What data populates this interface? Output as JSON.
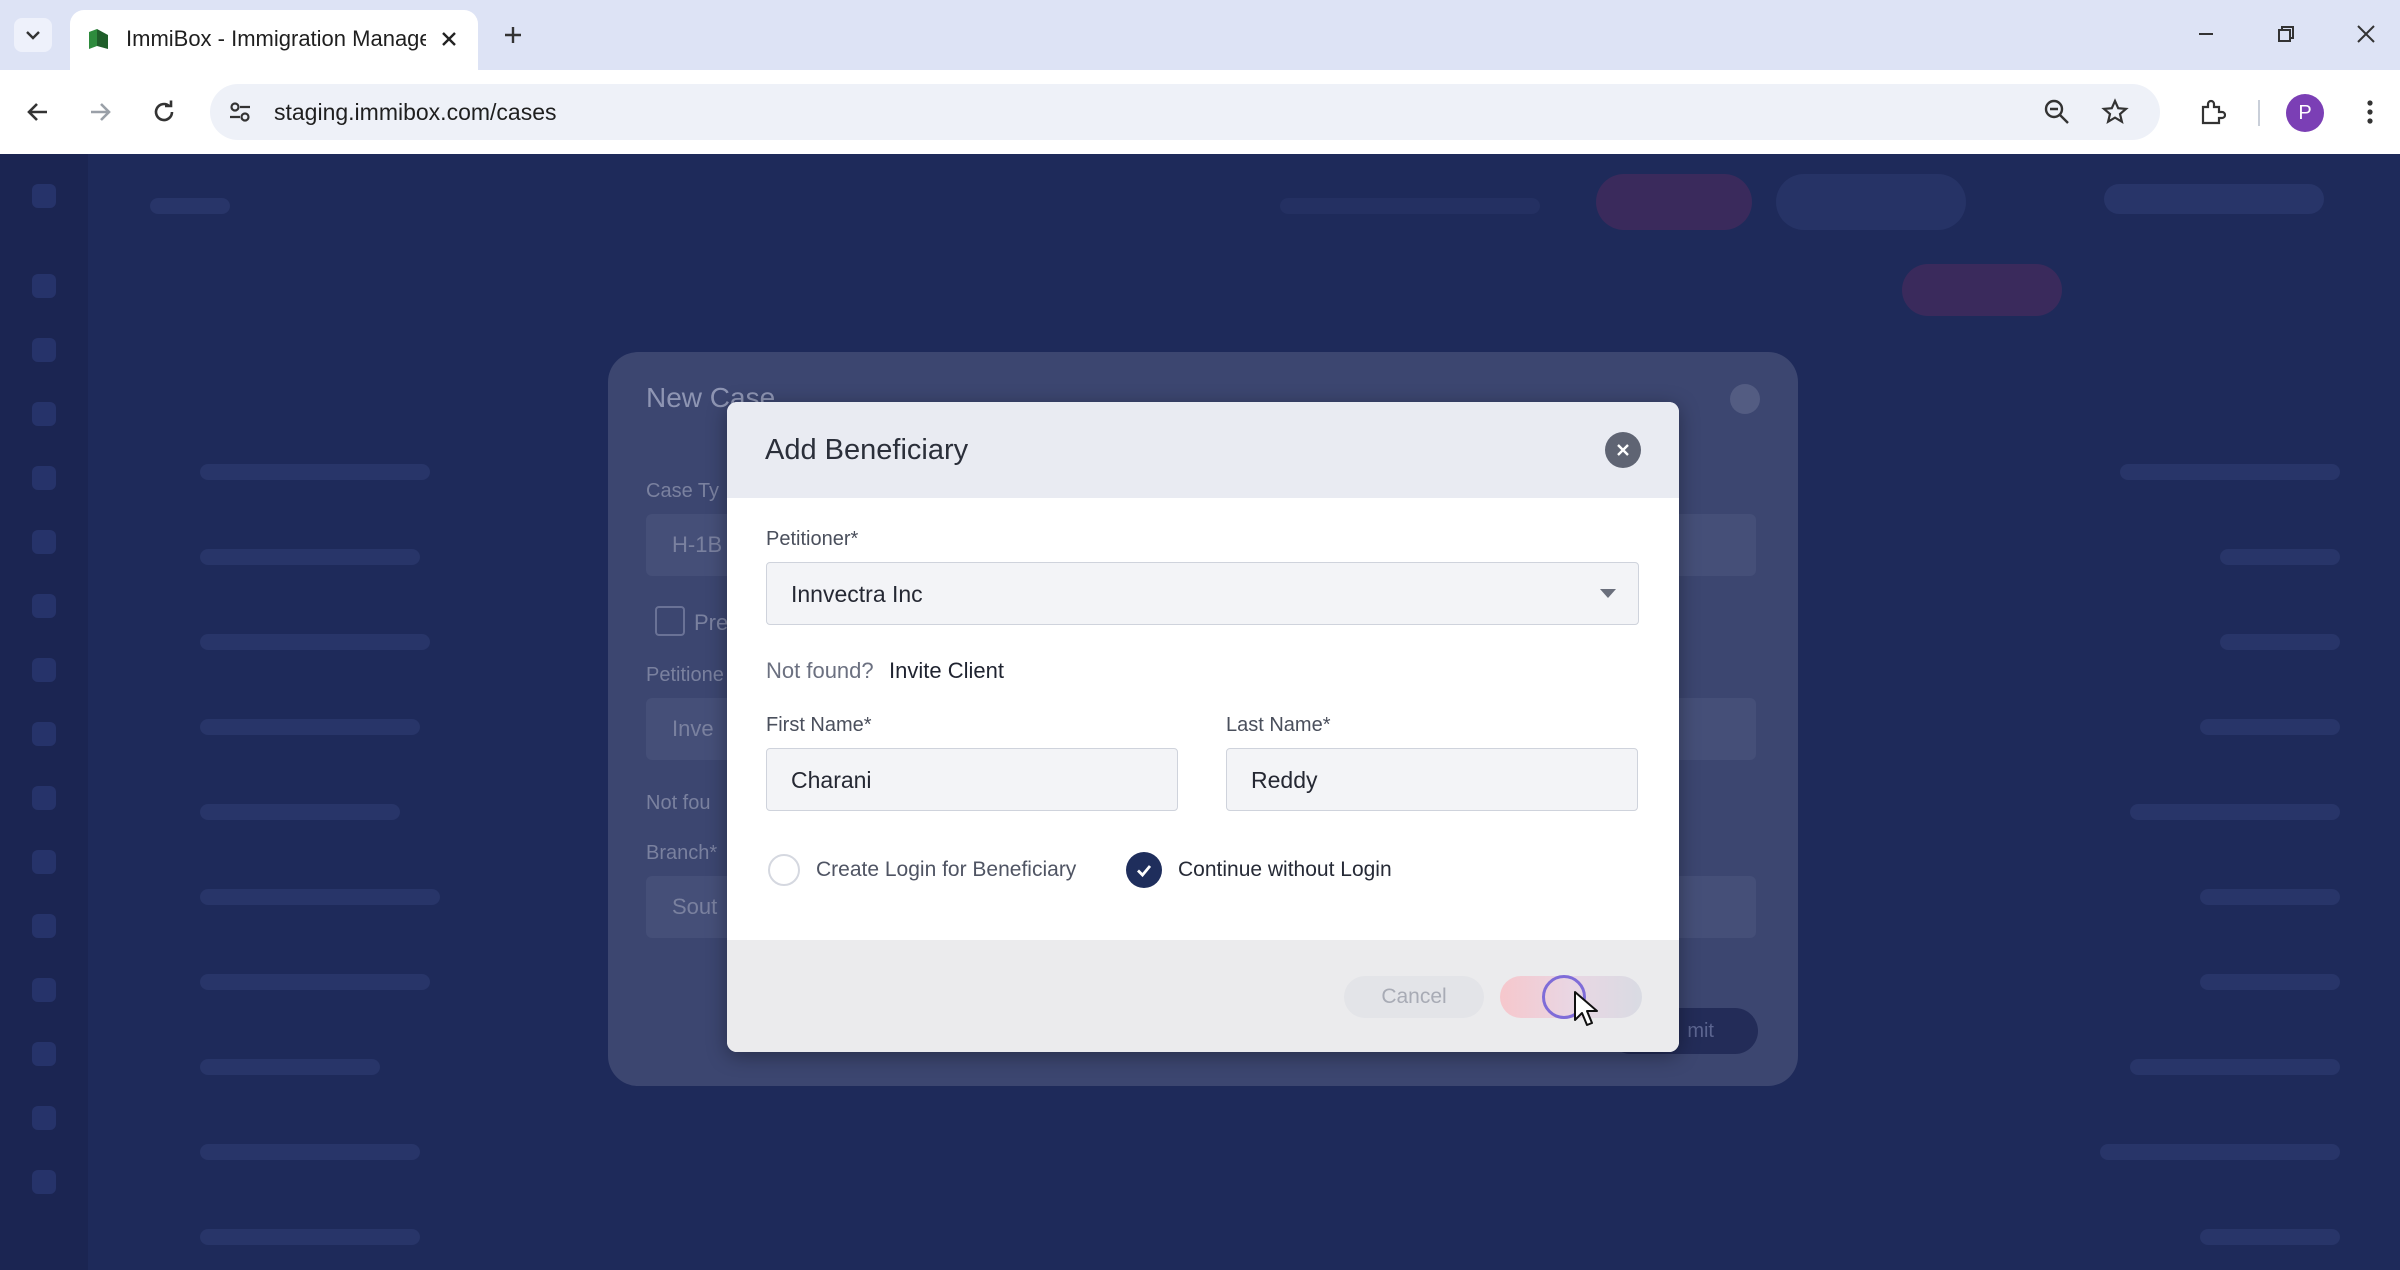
{
  "browser": {
    "tab_title": "ImmiBox - Immigration Management",
    "url": "staging.immibox.com/cases",
    "avatar_initial": "P"
  },
  "background_modal": {
    "title": "New Case",
    "case_type_label": "Case Ty",
    "case_type_value": "H-1B",
    "checkbox_label": "Pre",
    "petitioner_label": "Petitione",
    "petitioner_value": "Inve",
    "not_found_label": "Not fou",
    "branch_label": "Branch*",
    "branch_value": "Sout",
    "submit_label": "mit"
  },
  "dialog": {
    "title": "Add Beneficiary",
    "petitioner_label": "Petitioner*",
    "petitioner_value": "Innvectra Inc",
    "not_found_text": "Not found?",
    "invite_link": "Invite Client",
    "first_name_label": "First Name*",
    "first_name_value": "Charani",
    "last_name_label": "Last Name*",
    "last_name_value": "Reddy",
    "option_create_login": "Create Login for Beneficiary",
    "option_continue_without": "Continue without Login",
    "cancel_label": "Cancel"
  },
  "colors": {
    "dialog_accent": "#1f2e5c",
    "avatar": "#7b3fb5",
    "overlay": "#1e2a5a"
  }
}
